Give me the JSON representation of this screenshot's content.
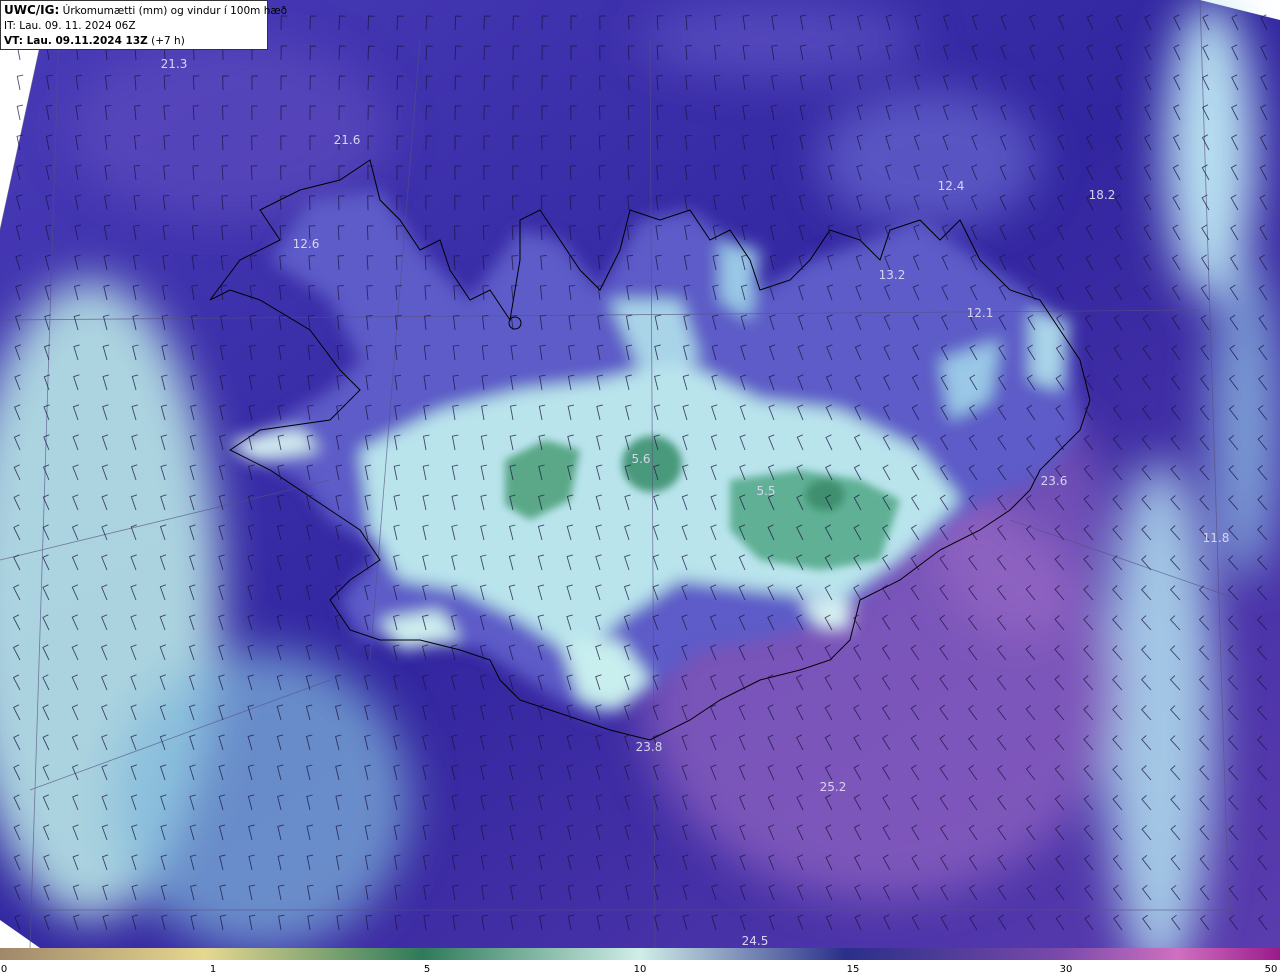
{
  "header": {
    "code": "UWC/IG:",
    "title": "Úrkomumætti (mm) og vindur í 100m hæð",
    "init_time": "IT: Lau. 09. 11. 2024 06Z",
    "valid_label": "VT: Lau. 09.11.2024 13Z",
    "valid_offset": "(+7 h)"
  },
  "map_labels": [
    {
      "id": "label-21-3",
      "text": "21.3"
    },
    {
      "id": "label-21-6",
      "text": "21.6"
    },
    {
      "id": "label-12-6",
      "text": "12.6"
    },
    {
      "id": "label-12-4",
      "text": "12.4"
    },
    {
      "id": "label-18-2",
      "text": "18.2"
    },
    {
      "id": "label-13-2",
      "text": "13.2"
    },
    {
      "id": "label-12-1",
      "text": "12.1"
    },
    {
      "id": "label-5-6",
      "text": "5.6"
    },
    {
      "id": "label-5-5",
      "text": "5.5"
    },
    {
      "id": "label-23-6",
      "text": "23.6"
    },
    {
      "id": "label-11-8",
      "text": "11.8"
    },
    {
      "id": "label-23-8",
      "text": "23.8"
    },
    {
      "id": "label-25-2",
      "text": "25.2"
    },
    {
      "id": "label-24-5",
      "text": "24.5"
    }
  ],
  "colorbar": {
    "ticks": [
      "0",
      "1",
      "5",
      "10",
      "15",
      "30",
      "50"
    ],
    "colors": [
      "#a0876a",
      "#e6d890",
      "#2e7a5a",
      "#cfeee8",
      "#2a2f8a",
      "#7a4aaa",
      "#d070c0",
      "#9a1a8a"
    ]
  },
  "colors": {
    "sea_deep": "#3a2fa8",
    "land_high": "#c6ece8",
    "green_core": "#3f9a7a",
    "coast": "#000000"
  }
}
